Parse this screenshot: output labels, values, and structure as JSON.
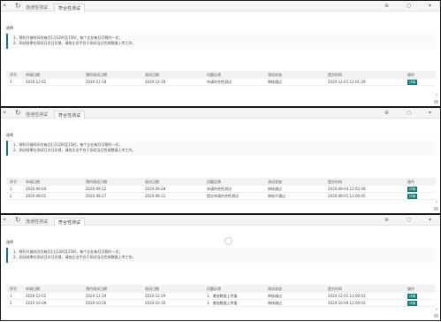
{
  "panels": [
    {
      "tabs": {
        "tab1": "连通性测试",
        "tab2": "符合性测试"
      },
      "label": "选择",
      "notice": [
        "1、预约开放时间为每月1日12时至15时，每个企业每月可预约一次；",
        "2、测试结果在测试日次日反馈，请各企业平台于测试当日完成数据上传工作。"
      ],
      "columns": [
        "序号",
        "申请日期",
        "预约测试日期",
        "测试日期",
        "问题反馈",
        "测试状态",
        "提交时间",
        "操作"
      ],
      "rows": [
        [
          "1",
          "2020-12-01",
          "2020-12-18",
          "2020-12-18",
          "申请符合性测试",
          "审核通过",
          "2020-12-01 12:01:29",
          "详情"
        ]
      ]
    },
    {
      "tabs": {
        "tab1": "连通性测试",
        "tab2": "符合性测试"
      },
      "label": "选择",
      "notice": [
        "1、预约开放时间为每月1日12时至15时，每个企业每月可预约一次；",
        "2、测试结果在测试日次日反馈，请各企业平台于测试当日完成数据上传工作。"
      ],
      "columns": [
        "序号",
        "申请日期",
        "预约测试日期",
        "测试日期",
        "问题反馈",
        "测试状态",
        "提交时间",
        "操作"
      ],
      "rows": [
        [
          "1",
          "2020-09-04",
          "2020-09-12",
          "2020-09-28",
          "申请符合性测试",
          "审核通过",
          "2020-09-04 12:02:48",
          "详情"
        ],
        [
          "2",
          "2020-08-01",
          "2020-08-27",
          "2020-08-31",
          "提交申请符合性测试",
          "审核不通过",
          "2020-08-01 12:00:45",
          "详情"
        ]
      ]
    },
    {
      "tabs": {
        "tab1": "连通性测试",
        "tab2": "符合性测试"
      },
      "label": "选择",
      "notice": [
        "1、预约开放时间为每月1日12时至15时，每个企业每月可预约一次；",
        "2、测试结果在测试日次日反馈，请各企业平台于测试当日完成数据上传工作。"
      ],
      "columns": [
        "序号",
        "申请日期",
        "预约测试日期",
        "测试日期",
        "问题反馈",
        "测试状态",
        "提交时间",
        "操作"
      ],
      "rows": [
        [
          "1",
          "2020-12-01",
          "2020-12-29",
          "2020-12-29",
          "1、增加数据上传量",
          "审核通过",
          "2020-12-01 12:00:03",
          "详情"
        ],
        [
          "2",
          "2020-10-09",
          "2020-10-26",
          "2020-10-30",
          "1、增加数据上传量",
          "审核通过",
          "2020-10-09 12:00:03",
          "详情"
        ]
      ]
    }
  ],
  "theme": {
    "accent": "#0c7d6f",
    "tab_bar": "#f4f4f4",
    "header_row": "#f2f2f2"
  },
  "icons": {
    "back": "double-chevron-left-icon",
    "home": "refresh-icon",
    "more": "chevron-down-icon"
  }
}
